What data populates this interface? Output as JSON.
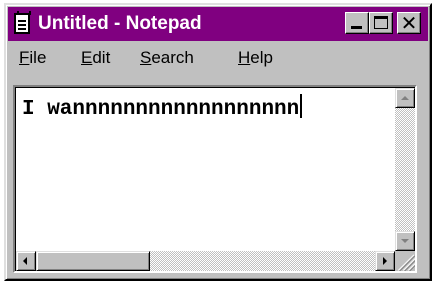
{
  "window": {
    "title": "Untitled - Notepad",
    "title_bar_color": "#800080",
    "icon": "notepad-icon"
  },
  "controls": {
    "minimize_icon": "minimize-icon",
    "maximize_icon": "maximize-icon",
    "close_glyph": "✕"
  },
  "menu": {
    "items": [
      {
        "label": "File"
      },
      {
        "label": "Edit"
      },
      {
        "label": "Search"
      },
      {
        "label": "Help"
      }
    ]
  },
  "editor": {
    "text": "I wannnnnnnnnnnnnnnnnn"
  }
}
